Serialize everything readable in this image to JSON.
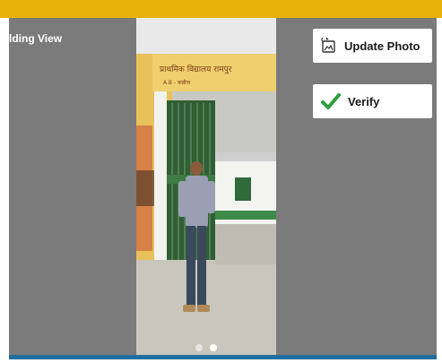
{
  "header": {
    "accent_color": "#e8b10a"
  },
  "panel": {
    "title": "lding View",
    "background": "#7b7b7b"
  },
  "photo": {
    "sign_text": "प्राथमिक विद्यालय रामपुर",
    "sign_subtext": "A.B - कन्नौज",
    "pager_count": 2,
    "pager_active": 1
  },
  "actions": {
    "update_photo_label": "Update Photo",
    "update_photo_icon": "photo-update-icon",
    "verify_label": "Verify",
    "verify_icon": "check-icon",
    "verify_icon_color": "#2e9e3e"
  },
  "footer": {
    "accent_color": "#1e6fa0"
  }
}
